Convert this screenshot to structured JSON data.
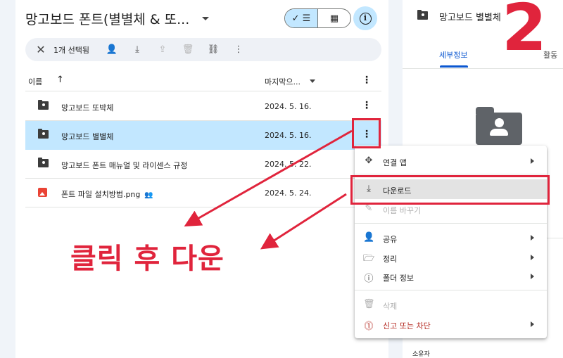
{
  "header": {
    "title": "망고보드 폰트(별별체 & 또...",
    "view_list_glyph": "✓ ☰",
    "view_grid_glyph": "▦",
    "info_glyph": "i"
  },
  "selection_bar": {
    "close_glyph": "✕",
    "count_label": "1개 선택됨",
    "icons": [
      "add-person-icon",
      "download-icon",
      "move-icon",
      "trash-icon",
      "link-icon",
      "more-vert-icon"
    ],
    "add_person_glyph": "👤",
    "download_glyph": "⤓",
    "move_glyph": "⇪",
    "trash_glyph": "🗑",
    "link_glyph": "⛓",
    "more_glyph": "⋮"
  },
  "table": {
    "columns": {
      "name": "이름",
      "modified": "마지막으...",
      "sort_glyph": "↑",
      "more_glyph": "⋮"
    },
    "rows": [
      {
        "name": "망고보드 또박체",
        "date": "2024. 5. 16.",
        "type": "shared-folder"
      },
      {
        "name": "망고보드 별별체",
        "date": "2024. 5. 16.",
        "type": "shared-folder",
        "selected": true
      },
      {
        "name": "망고보드 폰트 매뉴얼 및 라이센스 규정",
        "date": "2024. 5. 22.",
        "type": "shared-folder"
      },
      {
        "name": "폰트 파일 설치방법.png",
        "date": "2024. 5. 24.",
        "type": "image",
        "shared_glyph": "👥"
      }
    ],
    "row_more_glyph": "⋮"
  },
  "detail_panel": {
    "title": "망고보드 별별체",
    "tab_details": "세부정보",
    "tab_activity": "활동",
    "owner_label": "소유자"
  },
  "context_menu": {
    "items": [
      {
        "label": "연결 앱",
        "icon": "move-arrows-icon",
        "glyph": "✥",
        "submenu": true
      },
      {
        "label": "다운로드",
        "icon": "download-icon",
        "glyph": "⤓",
        "highlighted": true
      },
      {
        "label": "이름 바꾸기",
        "icon": "edit-icon",
        "glyph": "✎",
        "disabled": true
      },
      {
        "label": "공유",
        "icon": "add-person-icon",
        "glyph": "👤",
        "submenu": true
      },
      {
        "label": "정리",
        "icon": "folder-open-icon",
        "glyph": "🗁",
        "submenu": true
      },
      {
        "label": "폴더 정보",
        "icon": "info-icon",
        "glyph": "ⓘ",
        "submenu": true
      },
      {
        "label": "삭제",
        "icon": "trash-icon",
        "glyph": "🗑",
        "disabled": true
      },
      {
        "label": "신고 또는 차단",
        "icon": "report-icon",
        "glyph": "⓵",
        "submenu": true,
        "danger": true
      }
    ]
  },
  "annotations": {
    "step_number": "2",
    "instruction": "클릭 후 다운",
    "color": "#e0243c"
  },
  "colors": {
    "selected_row": "#c2e7ff",
    "accent": "#0b57d0",
    "danger": "#b3261e",
    "annotation": "#e0243c"
  }
}
